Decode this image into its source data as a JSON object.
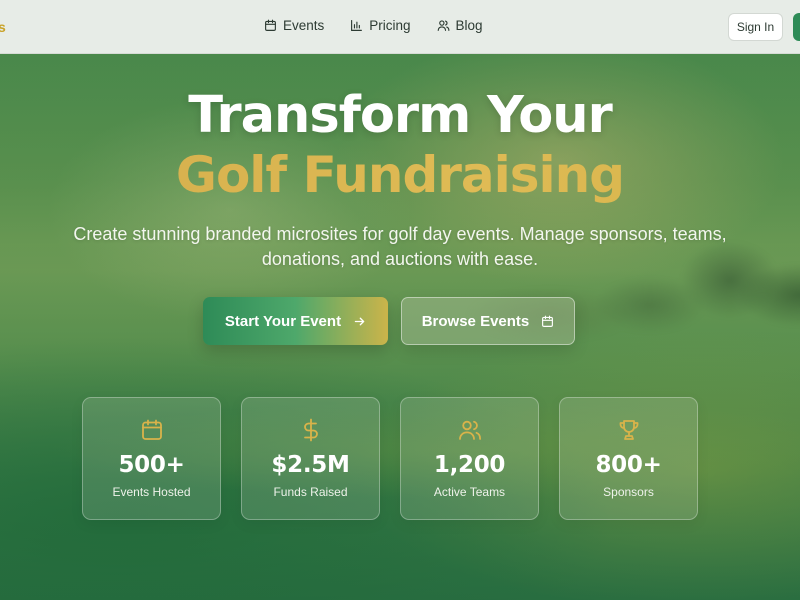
{
  "nav": {
    "brand_fragment": "s",
    "links": [
      {
        "label": "Events",
        "icon": "calendar-icon"
      },
      {
        "label": "Pricing",
        "icon": "bar-chart-icon"
      },
      {
        "label": "Blog",
        "icon": "users-icon"
      }
    ],
    "signin_label": "Sign In"
  },
  "hero": {
    "title_line1": "Transform Your",
    "title_line2": "Golf Fundraising",
    "subtitle": "Create stunning branded microsites for golf day events. Manage sponsors, teams, donations, and auctions with ease.",
    "primary_cta": {
      "label": "Start Your Event",
      "icon": "arrow-right-icon"
    },
    "secondary_cta": {
      "label": "Browse Events",
      "icon": "calendar-icon"
    }
  },
  "stats": [
    {
      "value": "500+",
      "label": "Events Hosted",
      "icon": "calendar-icon"
    },
    {
      "value": "$2.5M",
      "label": "Funds Raised",
      "icon": "dollar-icon"
    },
    {
      "value": "1,200",
      "label": "Active Teams",
      "icon": "users-icon"
    },
    {
      "value": "800+",
      "label": "Sponsors",
      "icon": "trophy-icon"
    }
  ],
  "colors": {
    "accent_gold": "#d4ad4b",
    "brand_green": "#2e8b57",
    "nav_text": "#2d3b33"
  }
}
